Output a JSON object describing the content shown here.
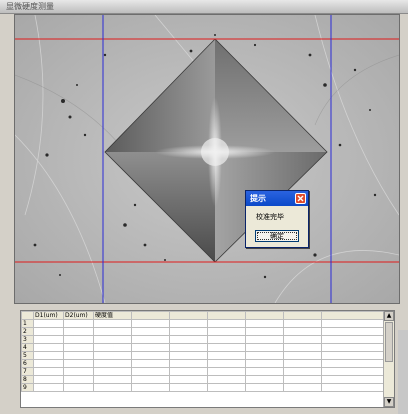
{
  "window": {
    "title": "显微硬度测量"
  },
  "dialog": {
    "title": "提示",
    "message": "校准完毕",
    "ok_label": "确定"
  },
  "table": {
    "columns": [
      "D1(um)",
      "D2(um)",
      "硬度值",
      "",
      "",
      "",
      "",
      "",
      ""
    ],
    "rows": [
      "1",
      "2",
      "3",
      "4",
      "5",
      "6",
      "7",
      "8",
      "9"
    ]
  },
  "colors": {
    "guide_line_red": "#e01b1b",
    "guide_line_blue": "#2b2bd6",
    "dialog_title": "#0b49c9"
  }
}
